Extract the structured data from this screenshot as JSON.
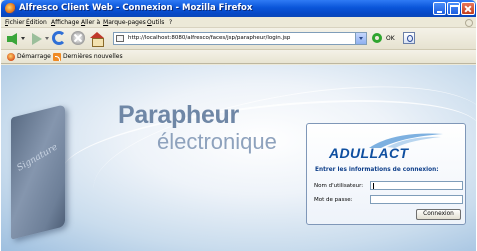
{
  "window": {
    "title": "Alfresco Client Web - Connexion - Mozilla Firefox"
  },
  "menubar": {
    "items": [
      "Fichier",
      "Édition",
      "Affichage",
      "Aller à",
      "Marque-pages",
      "Outils",
      "?"
    ]
  },
  "navbar": {
    "url": "http://localhost:8080/alfresco/faces/jsp/parapheur/login.jsp",
    "go_label": "OK"
  },
  "bookmarks": {
    "items": [
      "Démarrage",
      "Dernières nouvelles"
    ]
  },
  "page": {
    "brand_title": "Parapheur",
    "brand_subtitle": "électronique",
    "book_script": "Signature",
    "login": {
      "logo_text": "ADULLACT",
      "heading": "Entrer les informations de connexion:",
      "username_label": "Nom d'utilisateur:",
      "username_value": "",
      "password_label": "Mot de passe:",
      "password_value": "",
      "submit_label": "Connexion"
    }
  },
  "colors": {
    "titlebar": "#0a55d9",
    "brand_text": "#6f87a6",
    "logo": "#0f4fa0",
    "background": "#c9dced"
  }
}
